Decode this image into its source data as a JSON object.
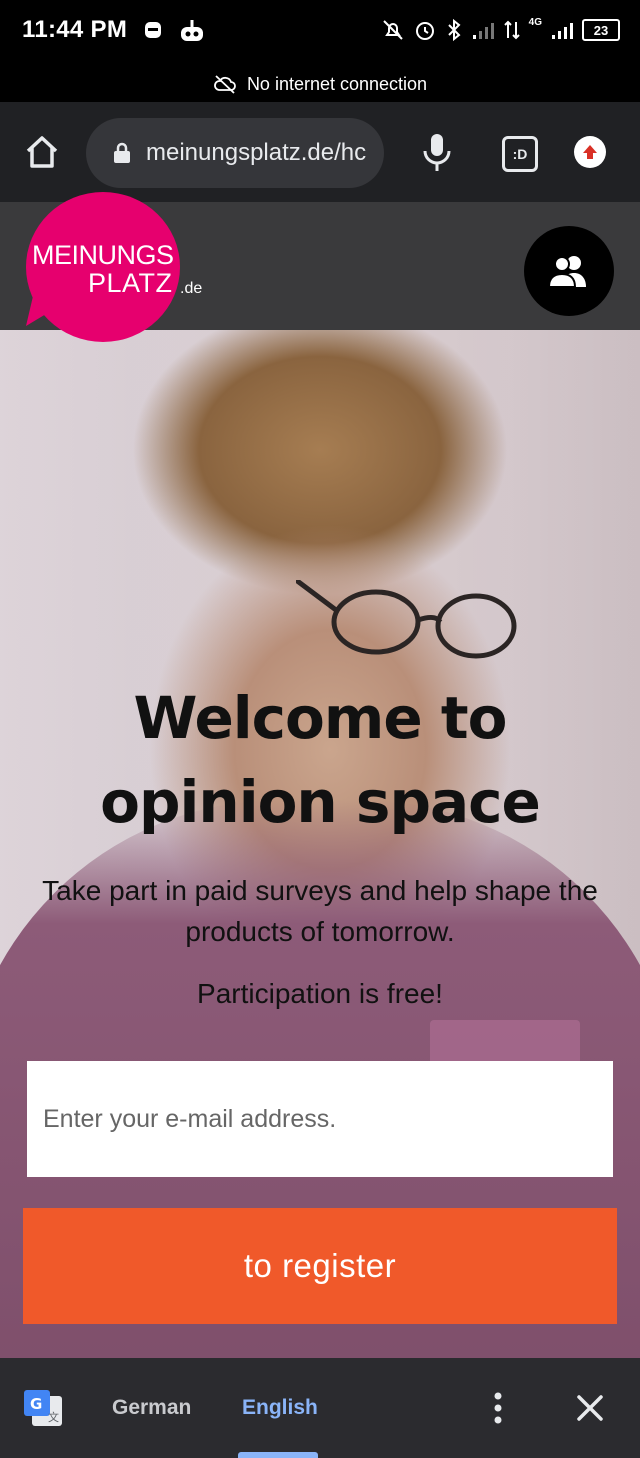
{
  "status_bar": {
    "time": "11:44 PM",
    "signal": "4G",
    "battery": "23"
  },
  "network_banner": {
    "text": "No internet connection"
  },
  "browser": {
    "url": "meinungsplatz.de/hc",
    "tab_badge": ":D"
  },
  "site": {
    "logo_line1": "MEINUNGS",
    "logo_line2": "PLATZ",
    "logo_tld": ".de"
  },
  "hero": {
    "title_line1": "Welcome to",
    "title_line2": "opinion space",
    "subtitle": "Take part in paid surveys and help shape the products of tomorrow.",
    "free_note": "Participation is free!",
    "email_placeholder": "Enter your e-mail address.",
    "register_label": "to register"
  },
  "translate_bar": {
    "from_lang": "German",
    "to_lang": "English"
  },
  "colors": {
    "brand_pink": "#e6006e",
    "cta_orange": "#f0592a",
    "translate_accent": "#8ab4f8"
  }
}
